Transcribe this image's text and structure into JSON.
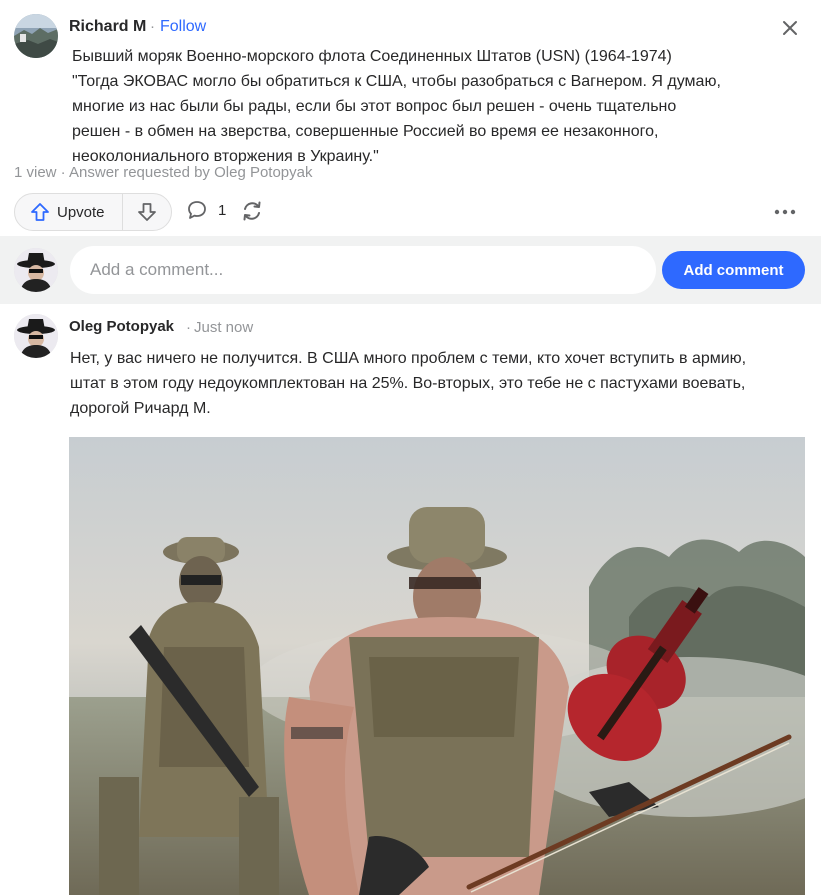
{
  "answer": {
    "author": "Richard M",
    "separator": "·",
    "follow_label": "Follow",
    "body_lines": [
      "Бывший моряк Военно-морского флота Соединенных Штатов (USN) (1964-1974)",
      "\"Тогда ЭКОВАС могло бы обратиться к США, чтобы разобраться с Вагнером. Я думаю,",
      "многие из нас были бы рады, если бы этот вопрос был решен - очень тщательно",
      "решен - в обмен на зверства, совершенные Россией во время ее незаконного,",
      "неоколониального вторжения в Украину.\""
    ],
    "meta": "1 view · Answer requested by Oleg Potopyak",
    "upvote_label": "Upvote",
    "comment_count": "1",
    "icons": {
      "close": "close-icon",
      "upvote": "arrow-up-icon",
      "downvote": "arrow-down-icon",
      "comment": "speech-bubble-icon",
      "share": "refresh-share-icon",
      "more": "more-dots-icon"
    }
  },
  "comment_box": {
    "placeholder": "Add a comment...",
    "button_label": "Add comment"
  },
  "reply": {
    "author": "Oleg Potopyak",
    "separator": "·",
    "time": "Just now",
    "body_lines": [
      "Нет, у вас ничего не получится. В США много проблем с теми, кто хочет вступить в армию,",
      "штат в этом году недоукомплектован на 25%. Во-вторых, это тебе не с пастухами воевать,",
      "дорогой Ричард М."
    ]
  },
  "colors": {
    "accent": "#2e69ff",
    "text": "#282829",
    "muted": "#939598",
    "comment_bar_bg": "#f1f2f2"
  }
}
